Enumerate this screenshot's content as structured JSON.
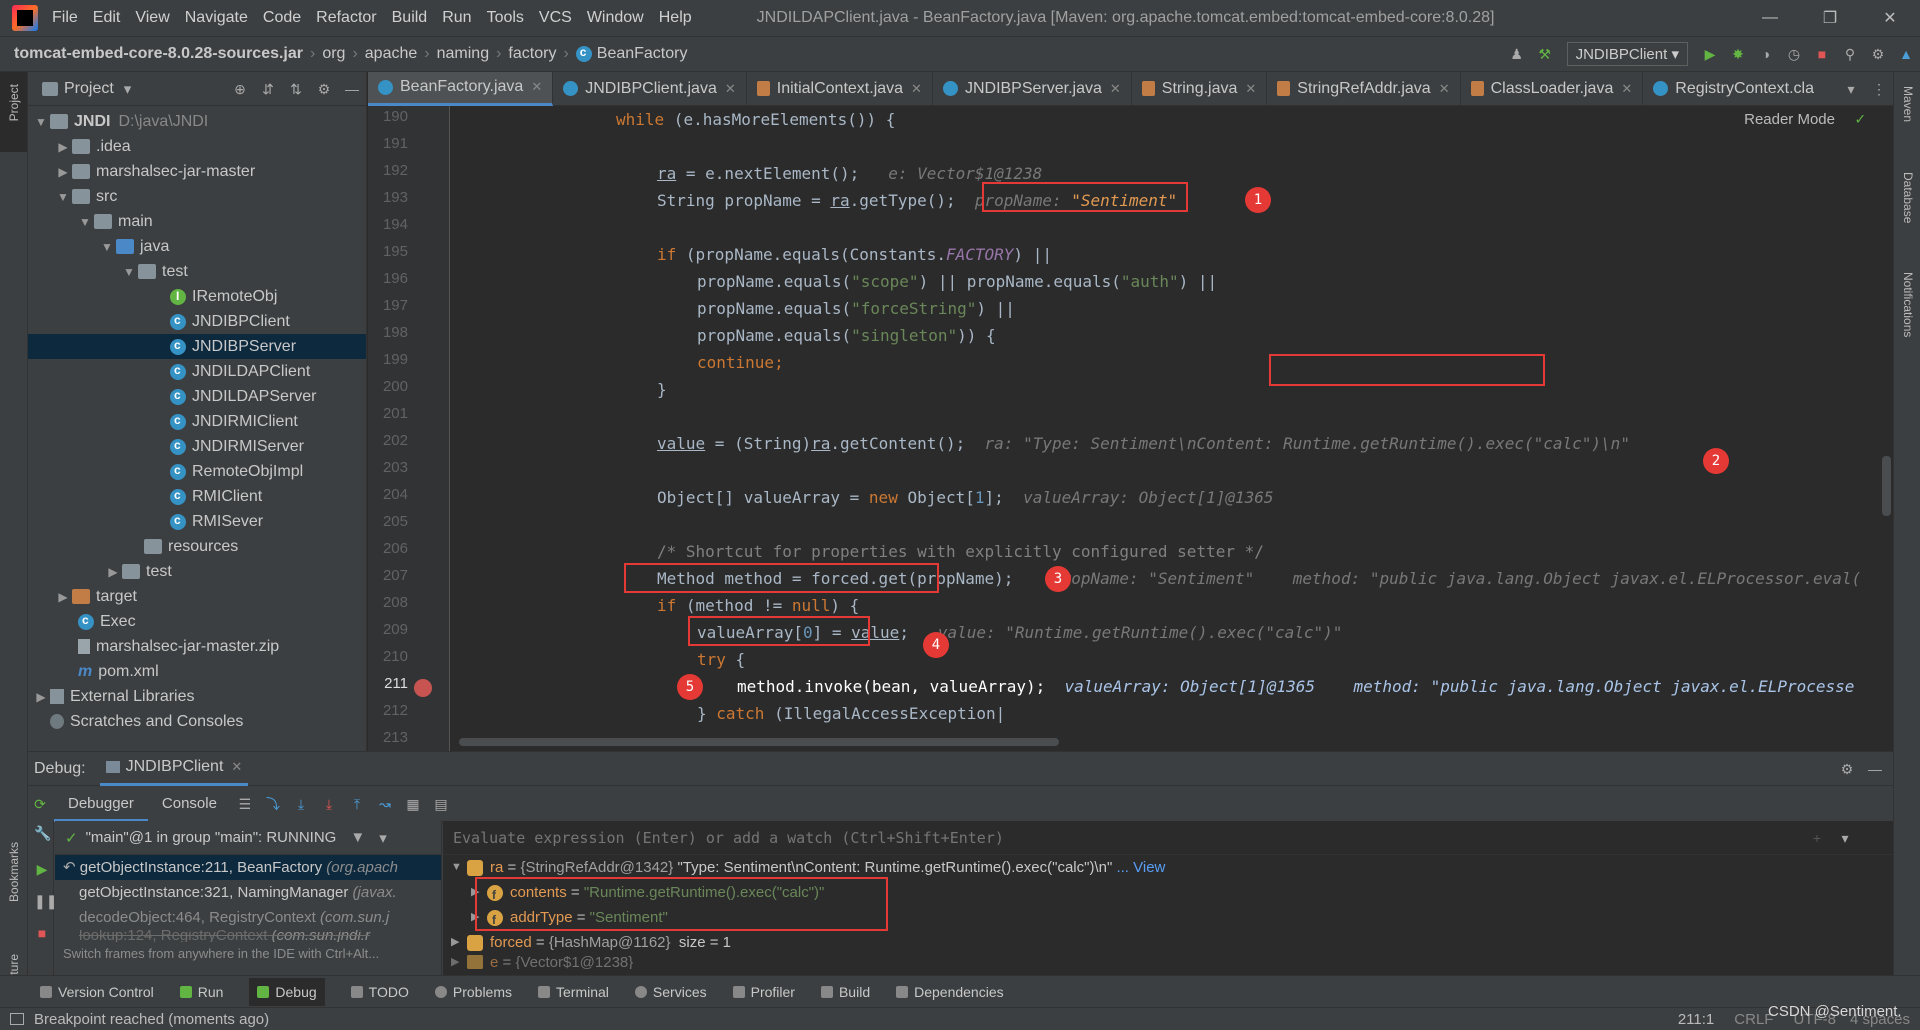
{
  "menubar": {
    "items": [
      "File",
      "Edit",
      "View",
      "Navigate",
      "Code",
      "Refactor",
      "Build",
      "Run",
      "Tools",
      "VCS",
      "Window",
      "Help"
    ],
    "window_title": "JNDILDAPClient.java - BeanFactory.java [Maven: org.apache.tomcat.embed:tomcat-embed-core:8.0.28]"
  },
  "navbar": {
    "crumbs": [
      "tomcat-embed-core-8.0.28-sources.jar",
      "org",
      "apache",
      "naming",
      "factory",
      "BeanFactory"
    ],
    "run_config": "JNDIBPClient"
  },
  "side": {
    "project_label": "Project",
    "bookmarks": "Bookmarks",
    "structure": "Structure",
    "maven": "Maven",
    "database": "Database",
    "notifications": "Notifications"
  },
  "project": {
    "header": "Project",
    "tree": [
      {
        "label": "JNDI",
        "extra": "D:\\java\\JNDI"
      },
      {
        "label": ".idea"
      },
      {
        "label": "marshalsec-jar-master"
      },
      {
        "label": "src"
      },
      {
        "label": "main"
      },
      {
        "label": "java"
      },
      {
        "label": "test"
      },
      {
        "label": "IRemoteObj"
      },
      {
        "label": "JNDIBPClient"
      },
      {
        "label": "JNDIBPServer"
      },
      {
        "label": "JNDILDAPClient"
      },
      {
        "label": "JNDILDAPServer"
      },
      {
        "label": "JNDIRMIClient"
      },
      {
        "label": "JNDIRMIServer"
      },
      {
        "label": "RemoteObjImpl"
      },
      {
        "label": "RMIClient"
      },
      {
        "label": "RMISever"
      },
      {
        "label": "resources"
      },
      {
        "label": "test"
      },
      {
        "label": "target"
      },
      {
        "label": "Exec"
      },
      {
        "label": "marshalsec-jar-master.zip"
      },
      {
        "label": "pom.xml"
      },
      {
        "label": "External Libraries"
      },
      {
        "label": "Scratches and Consoles"
      }
    ]
  },
  "tabs": [
    "BeanFactory.java",
    "JNDIBPClient.java",
    "InitialContext.java",
    "JNDIBPServer.java",
    "String.java",
    "StringRefAddr.java",
    "ClassLoader.java",
    "RegistryContext.cla"
  ],
  "editor": {
    "reader_mode": "Reader Mode",
    "line_numbers": [
      "190",
      "191",
      "192",
      "193",
      "194",
      "195",
      "196",
      "197",
      "198",
      "199",
      "200",
      "201",
      "202",
      "203",
      "204",
      "205",
      "206",
      "207",
      "208",
      "209",
      "210",
      "211",
      "212",
      "213"
    ],
    "inline": {
      "l192": "e: Vector$1@1238",
      "l193": "propName: ",
      "l193v": "\"Sentiment\"",
      "l202a": "ra: \"Type: Sentiment\\nContent: ",
      "l202b": "Runtime.getRuntime().exec(\"calc\")",
      "l202c": "\\n\"",
      "l204": "valueArray: Object[1]@1365",
      "l207": "propName: \"Sentiment\"    method: \"public java.lang.Object javax.el.ELProcessor.eval(",
      "l209": "value: \"Runtime.getRuntime().exec(\"calc\")\"",
      "l211": "valueArray: Object[1]@1365    method: \"public java.lang.Object javax.el.ELProcesse"
    },
    "badges": [
      "1",
      "2",
      "3",
      "4",
      "5"
    ]
  },
  "debug": {
    "label": "Debug:",
    "session": "JNDIBPClient",
    "tabs": [
      "Debugger",
      "Console"
    ],
    "thread": "\"main\"@1 in group \"main\": RUNNING",
    "eval_placeholder": "Evaluate expression (Enter) or add a watch (Ctrl+Shift+Enter)",
    "frames": [
      {
        "m": "getObjectInstance:211, BeanFactory",
        "p": "(org.apach"
      },
      {
        "m": "getObjectInstance:321, NamingManager",
        "p": "(javax."
      },
      {
        "m": "decodeObject:464, RegistryContext",
        "p": "(com.sun.j"
      },
      {
        "m": "lookup:124, RegistryContext",
        "p": "(com.sun.jndi.r"
      }
    ],
    "frames_hint": "Switch frames from anywhere in the IDE with Ctrl+Alt...",
    "vars": {
      "ra_name": "ra",
      "ra_type": "{StringRefAddr@1342}",
      "ra_val": "\"Type: Sentiment\\nContent: Runtime.getRuntime().exec(\"calc\")\\n\"",
      "ra_view": "... View",
      "contents_name": "contents",
      "contents_val": "\"Runtime.getRuntime().exec(\"calc\")\"",
      "addr_name": "addrType",
      "addr_val": "\"Sentiment\"",
      "forced_name": "forced",
      "forced_type": "{HashMap@1162}",
      "forced_size": "size = 1",
      "e_name": "e",
      "e_type": "{Vector$1@1238}"
    }
  },
  "bottombar": [
    "Version Control",
    "Run",
    "Debug",
    "TODO",
    "Problems",
    "Terminal",
    "Services",
    "Profiler",
    "Build",
    "Dependencies"
  ],
  "status": {
    "message": "Breakpoint reached (moments ago)",
    "position": "211:1",
    "line_sep": "CRLF",
    "encoding": "UTF-8",
    "indent": "4 spaces",
    "watermark": "CSDN @Sentiment."
  }
}
